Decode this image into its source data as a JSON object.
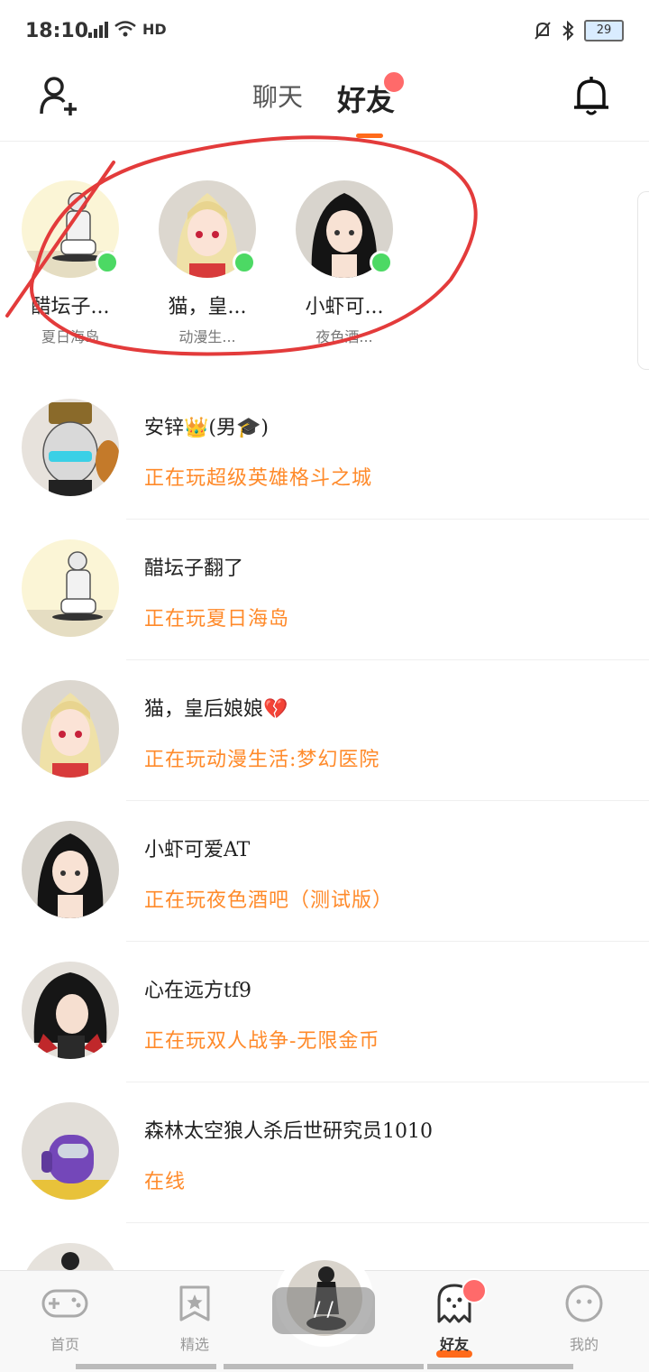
{
  "status_bar": {
    "time": "18:10",
    "hd": "HD",
    "battery": "29",
    "icons": [
      "signal-icon",
      "wifi-icon",
      "mute-icon",
      "bluetooth-icon",
      "battery-icon"
    ]
  },
  "header": {
    "tabs": [
      {
        "label": "聊天",
        "active": false
      },
      {
        "label": "好友",
        "active": true
      }
    ]
  },
  "online_friends": [
    {
      "name": "醋坛子...",
      "game": "夏日海岛"
    },
    {
      "name": "猫，皇...",
      "game": "动漫生..."
    },
    {
      "name": "小虾可...",
      "game": "夜色酒..."
    }
  ],
  "friends": [
    {
      "name": "安锌👑(男🎓)",
      "status": "正在玩超级英雄格斗之城"
    },
    {
      "name": "醋坛子翻了",
      "status": "正在玩夏日海岛"
    },
    {
      "name": "猫，皇后娘娘💔",
      "status": "正在玩动漫生活:梦幻医院"
    },
    {
      "name": "小虾可爱AT",
      "status": "正在玩夜色酒吧（测试版）"
    },
    {
      "name": "心在远方tf9",
      "status": "正在玩双人战争-无限金币"
    },
    {
      "name": "森林太空狼人杀后世研究员1010",
      "status": "在线"
    }
  ],
  "bottom_nav": {
    "items": [
      {
        "label": "首页"
      },
      {
        "label": "精选"
      },
      {
        "label": "好友"
      },
      {
        "label": "我的"
      }
    ],
    "center_label": "/ /"
  },
  "colors": {
    "accent": "#ff6a1a",
    "status_text": "#ff8a2a",
    "online": "#4cd964",
    "badge": "#ff6a6a",
    "annotation": "#e33b3b"
  }
}
